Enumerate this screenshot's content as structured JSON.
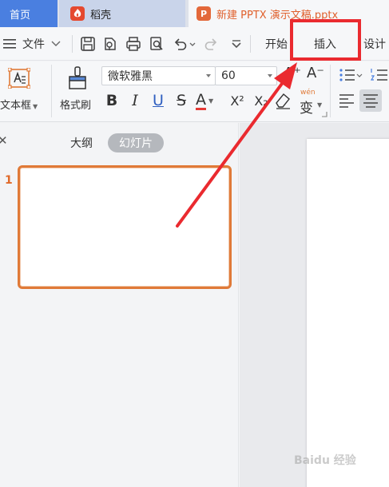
{
  "tabs": {
    "home": "首页",
    "daoke": "稻壳",
    "document": "新建 PPTX 演示文稿.pptx"
  },
  "menu": {
    "file": "文件",
    "start": "开始",
    "insert": "插入",
    "design": "设计"
  },
  "ribbon": {
    "textbox": "文本框",
    "format_painter": "格式刷",
    "font_name": "微软雅黑",
    "font_size": "60",
    "pinyin": "wén",
    "bold": "B",
    "italic": "I",
    "underline": "U",
    "strike": "S",
    "font_color": "A",
    "superscript": "X²",
    "subscript": "X₂",
    "increase_font": "A⁺",
    "decrease_font": "A⁻"
  },
  "left_panel": {
    "outline_tab": "大纲",
    "slides_tab": "幻灯片",
    "slide_number": "1"
  },
  "colors": {
    "home_tab": "#4a7fe0",
    "accent_orange": "#e07a38",
    "annotation_red": "#ea2a2f"
  },
  "watermark": "Baidu 经验"
}
